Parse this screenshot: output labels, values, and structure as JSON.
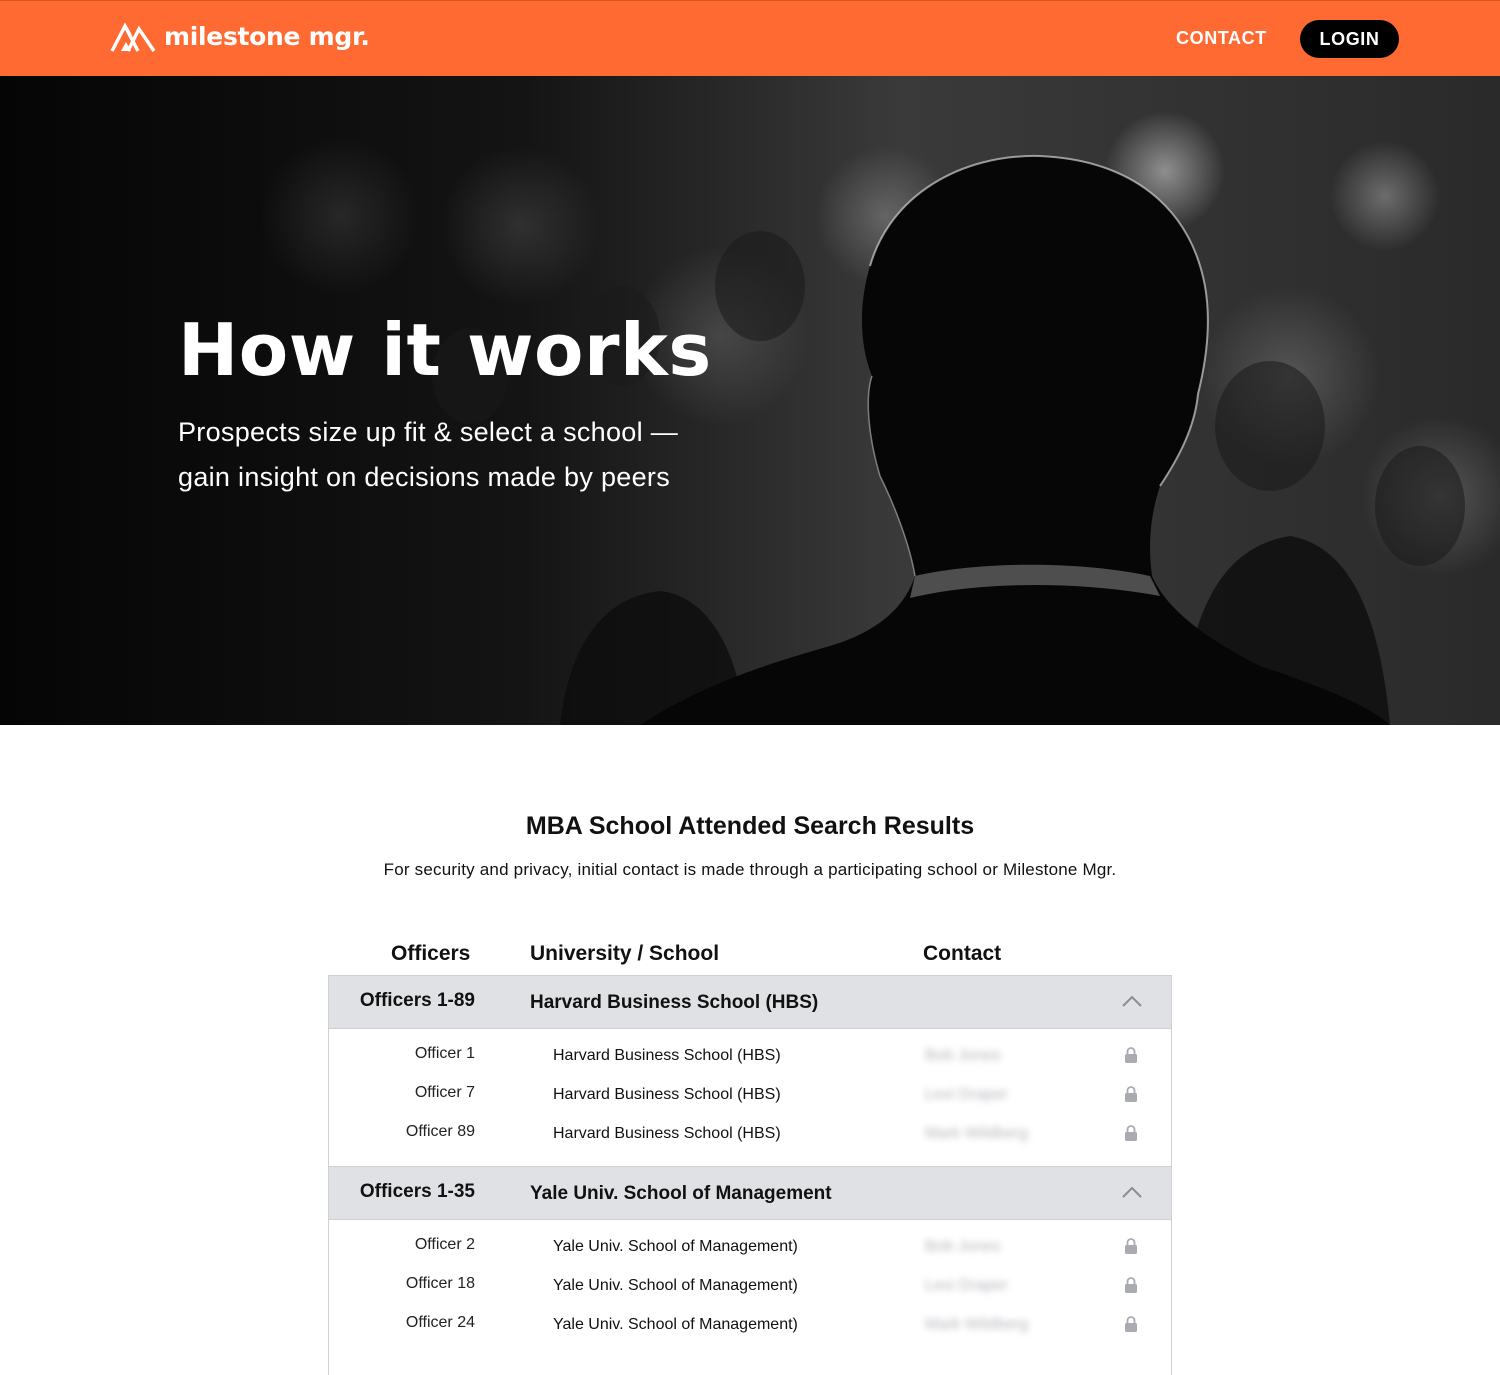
{
  "header": {
    "brand": "milestone mgr.",
    "nav_contact": "CONTACT",
    "nav_login": "LOGIN",
    "accent_color": "#ff6a33"
  },
  "hero": {
    "title": "How it works",
    "subtitle": "Prospects size up fit & select a school — gain insight on decisions made by peers"
  },
  "results": {
    "title": "MBA School Attended Search Results",
    "note": "For security and privacy, initial contact is made through a participating school or Milestone Mgr.",
    "columns": [
      "Officers",
      "University / School",
      "Contact"
    ],
    "groups": [
      {
        "officers": "Officers 1-89",
        "school": "Harvard Business School (HBS)",
        "rows": [
          {
            "officer": "Officer 1",
            "school": "Harvard Business School (HBS)",
            "contact": "Bob Jones"
          },
          {
            "officer": "Officer 7",
            "school": "Harvard Business School (HBS)",
            "contact": "Lexi Draper"
          },
          {
            "officer": "Officer 89",
            "school": "Harvard Business School (HBS)",
            "contact": "Mark Wildberg"
          }
        ]
      },
      {
        "officers": "Officers 1-35",
        "school": "Yale Univ. School of Management",
        "rows": [
          {
            "officer": "Officer 2",
            "school": "Yale Univ. School of Management)",
            "contact": "Bob Jones"
          },
          {
            "officer": "Officer 18",
            "school": "Yale Univ. School of Management)",
            "contact": "Lexi Draper"
          },
          {
            "officer": "Officer 24",
            "school": "Yale Univ. School of Management)",
            "contact": "Mark Wildberg"
          }
        ]
      }
    ]
  }
}
